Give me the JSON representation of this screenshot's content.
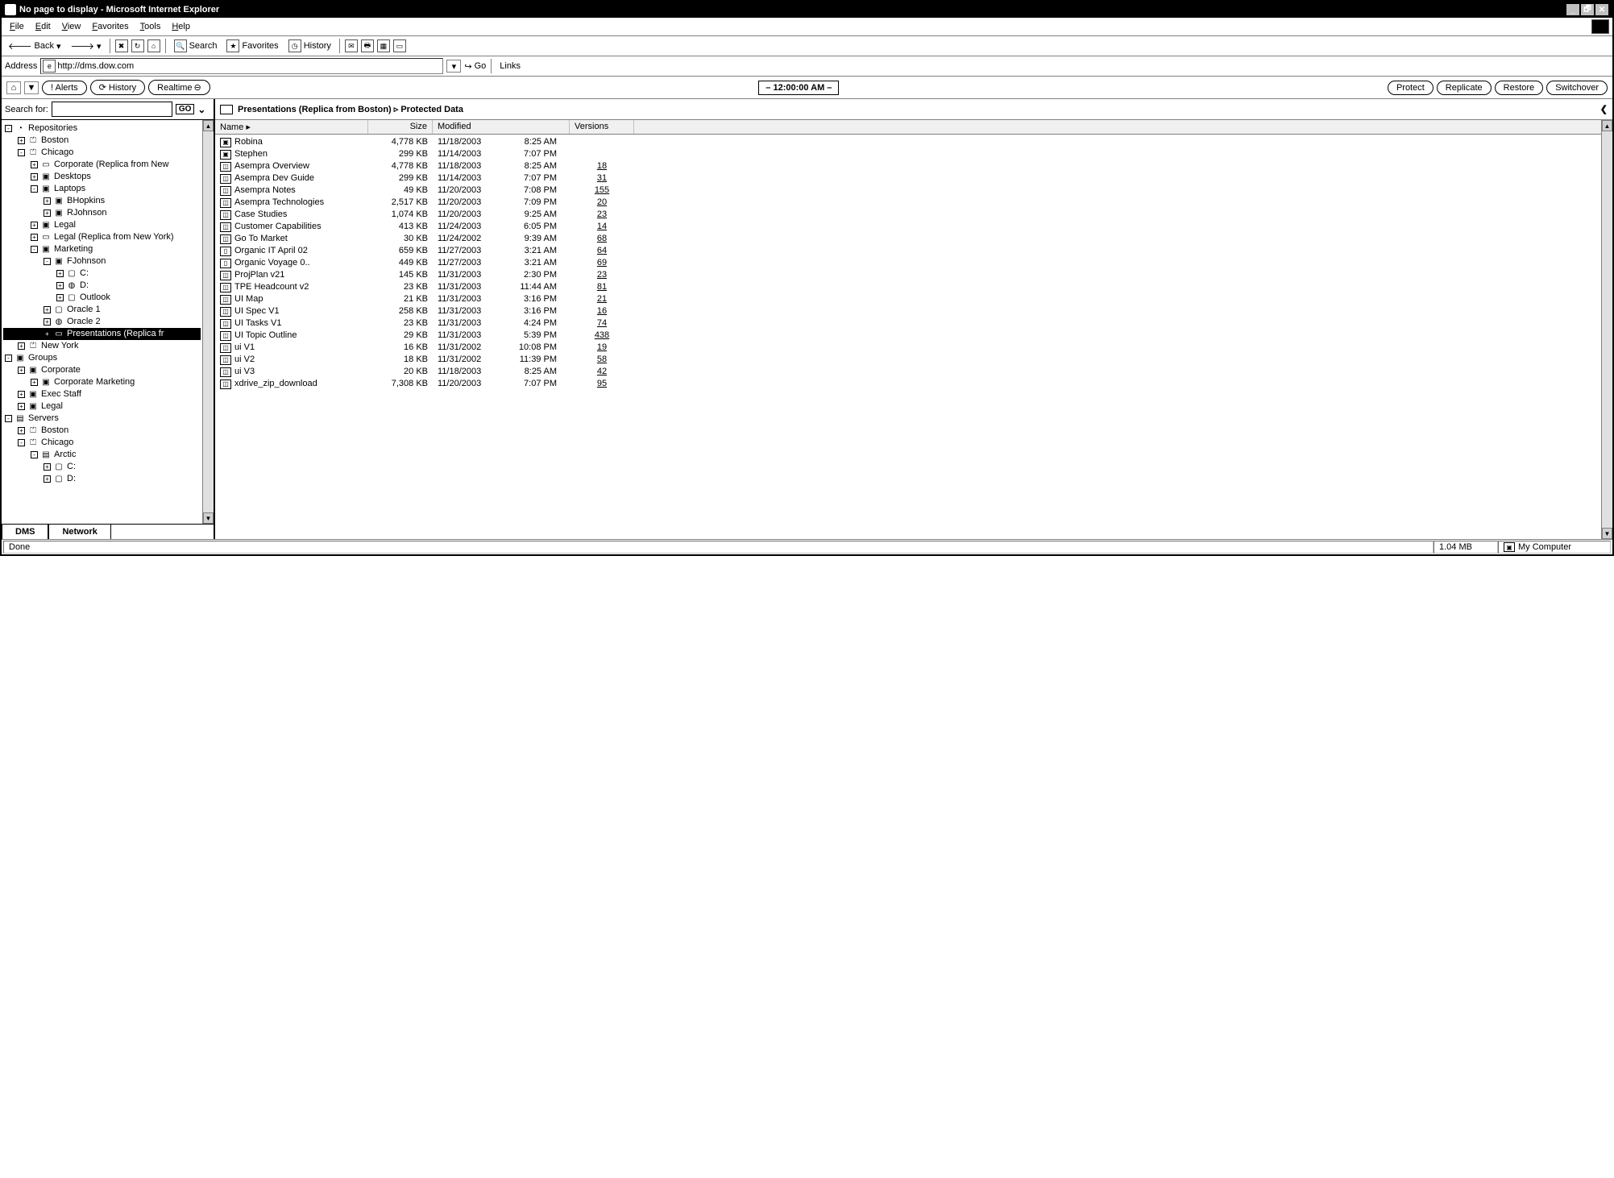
{
  "window": {
    "title": "No page to display - Microsoft Internet Explorer",
    "min": "_",
    "max": "🗗",
    "close": "✕"
  },
  "menu": {
    "items": [
      "File",
      "Edit",
      "View",
      "Favorites",
      "Tools",
      "Help"
    ]
  },
  "toolbar": {
    "back": "Back",
    "search": "Search",
    "favorites": "Favorites",
    "history": "History"
  },
  "address": {
    "label": "Address",
    "url": "http://dms.dow.com",
    "go": "Go",
    "links": "Links"
  },
  "appbar": {
    "alerts": "! Alerts",
    "history": "History",
    "realtime": "Realtime",
    "time": "– 12:00:00 AM –",
    "protect": "Protect",
    "replicate": "Replicate",
    "restore": "Restore",
    "switchover": "Switchover"
  },
  "search": {
    "label": "Search for:",
    "go": "GO"
  },
  "tree": {
    "scroll_up": "▲",
    "scroll_down": "▼",
    "tabs": {
      "dms": "DMS",
      "network": "Network"
    },
    "items": [
      {
        "ind": 0,
        "exp": "-",
        "icon": "◔",
        "label": "Repositories"
      },
      {
        "ind": 1,
        "exp": "+",
        "icon": "⏍",
        "label": "Boston"
      },
      {
        "ind": 1,
        "exp": "-",
        "icon": "⏍",
        "label": "Chicago"
      },
      {
        "ind": 2,
        "exp": "+",
        "icon": "▭",
        "label": "Corporate  (Replica from New"
      },
      {
        "ind": 2,
        "exp": "+",
        "icon": "▣",
        "label": "Desktops"
      },
      {
        "ind": 2,
        "exp": "-",
        "icon": "▣",
        "label": "Laptops"
      },
      {
        "ind": 3,
        "exp": "+",
        "icon": "▣",
        "label": "BHopkins"
      },
      {
        "ind": 3,
        "exp": "+",
        "icon": "▣",
        "label": "RJohnson"
      },
      {
        "ind": 2,
        "exp": "+",
        "icon": "▣",
        "label": "Legal"
      },
      {
        "ind": 2,
        "exp": "+",
        "icon": "▭",
        "label": "Legal (Replica from New York)"
      },
      {
        "ind": 2,
        "exp": "-",
        "icon": "▣",
        "label": "Marketing"
      },
      {
        "ind": 3,
        "exp": "-",
        "icon": "▣",
        "label": "FJohnson"
      },
      {
        "ind": 4,
        "exp": "+",
        "icon": "▢",
        "label": "C:"
      },
      {
        "ind": 4,
        "exp": "+",
        "icon": "◍",
        "label": "D:"
      },
      {
        "ind": 4,
        "exp": "+",
        "icon": "▢",
        "label": "Outlook"
      },
      {
        "ind": 3,
        "exp": "+",
        "icon": "▢",
        "label": "Oracle 1"
      },
      {
        "ind": 3,
        "exp": "+",
        "icon": "◍",
        "label": "Oracle 2"
      },
      {
        "ind": 3,
        "exp": "+",
        "icon": "▭",
        "label": "Presentations (Replica fr",
        "selected": true
      },
      {
        "ind": 1,
        "exp": "+",
        "icon": "⏍",
        "label": "New York"
      },
      {
        "ind": 0,
        "exp": "-",
        "icon": "▣",
        "label": "Groups"
      },
      {
        "ind": 1,
        "exp": "+",
        "icon": "▣",
        "label": "Corporate"
      },
      {
        "ind": 2,
        "exp": "+",
        "icon": "▣",
        "label": "Corporate Marketing"
      },
      {
        "ind": 1,
        "exp": "+",
        "icon": "▣",
        "label": "Exec Staff"
      },
      {
        "ind": 1,
        "exp": "+",
        "icon": "▣",
        "label": "Legal"
      },
      {
        "ind": 0,
        "exp": "-",
        "icon": "▤",
        "label": "Servers"
      },
      {
        "ind": 1,
        "exp": "+",
        "icon": "⏍",
        "label": "Boston"
      },
      {
        "ind": 1,
        "exp": "-",
        "icon": "⏍",
        "label": "Chicago"
      },
      {
        "ind": 2,
        "exp": "-",
        "icon": "▤",
        "label": "Arctic"
      },
      {
        "ind": 3,
        "exp": "+",
        "icon": "▢",
        "label": "C:"
      },
      {
        "ind": 3,
        "exp": "+",
        "icon": "▢",
        "label": "D:"
      }
    ]
  },
  "content": {
    "breadcrumb": "Presentations (Replica from Boston) ▹ Protected Data",
    "chev": "❮",
    "headers": {
      "name": "Name ▸",
      "size": "Size",
      "modified": "Modified",
      "versions": "Versions"
    },
    "rows": [
      {
        "icon": "▣",
        "name": "Robina",
        "size": "4,778 KB",
        "date": "11/18/2003",
        "time": "8:25 AM",
        "ver": ""
      },
      {
        "icon": "▣",
        "name": "Stephen",
        "size": "299 KB",
        "date": "11/14/2003",
        "time": "7:07 PM",
        "ver": ""
      },
      {
        "icon": "◫",
        "name": "Asempra Overview",
        "size": "4,778 KB",
        "date": "11/18/2003",
        "time": "8:25 AM",
        "ver": "18"
      },
      {
        "icon": "◫",
        "name": "Asempra Dev Guide",
        "size": "299 KB",
        "date": "11/14/2003",
        "time": "7:07 PM",
        "ver": "31"
      },
      {
        "icon": "◫",
        "name": "Asempra Notes",
        "size": "49 KB",
        "date": "11/20/2003",
        "time": "7:08 PM",
        "ver": "155"
      },
      {
        "icon": "◫",
        "name": "Asempra Technologies",
        "size": "2,517 KB",
        "date": "11/20/2003",
        "time": "7:09 PM",
        "ver": "20"
      },
      {
        "icon": "◫",
        "name": "Case Studies",
        "size": "1,074 KB",
        "date": "11/20/2003",
        "time": "9:25 AM",
        "ver": "23"
      },
      {
        "icon": "◫",
        "name": "Customer Capabilities",
        "size": "413 KB",
        "date": "11/24/2003",
        "time": "6:05 PM",
        "ver": "14"
      },
      {
        "icon": "◫",
        "name": "Go To Market",
        "size": "30 KB",
        "date": "11/24/2002",
        "time": "9:39 AM",
        "ver": "68"
      },
      {
        "icon": "▯",
        "name": "Organic IT April 02",
        "size": "659 KB",
        "date": "11/27/2003",
        "time": "3:21 AM",
        "ver": "64"
      },
      {
        "icon": "▯",
        "name": "Organic Voyage 0..",
        "size": "449 KB",
        "date": "11/27/2003",
        "time": "3:21 AM",
        "ver": "69"
      },
      {
        "icon": "◫",
        "name": "ProjPlan v21",
        "size": "145 KB",
        "date": "11/31/2003",
        "time": "2:30 PM",
        "ver": "23"
      },
      {
        "icon": "◫",
        "name": "TPE Headcount v2",
        "size": "23 KB",
        "date": "11/31/2003",
        "time": "11:44 AM",
        "ver": "81"
      },
      {
        "icon": "◫",
        "name": "UI Map",
        "size": "21 KB",
        "date": "11/31/2003",
        "time": "3:16 PM",
        "ver": "21"
      },
      {
        "icon": "◫",
        "name": "UI Spec V1",
        "size": "258 KB",
        "date": "11/31/2003",
        "time": "3:16 PM",
        "ver": "16"
      },
      {
        "icon": "◫",
        "name": "UI Tasks V1",
        "size": "23 KB",
        "date": "11/31/2003",
        "time": "4:24 PM",
        "ver": "74"
      },
      {
        "icon": "◫",
        "name": "UI Topic Outline",
        "size": "29 KB",
        "date": "11/31/2003",
        "time": "5:39 PM",
        "ver": "438"
      },
      {
        "icon": "◫",
        "name": "ui V1",
        "size": "16 KB",
        "date": "11/31/2002",
        "time": "10:08 PM",
        "ver": "19"
      },
      {
        "icon": "◫",
        "name": "ui V2",
        "size": "18 KB",
        "date": "11/31/2002",
        "time": "11:39 PM",
        "ver": "58"
      },
      {
        "icon": "◫",
        "name": "ui V3",
        "size": "20 KB",
        "date": "11/18/2003",
        "time": "8:25 AM",
        "ver": "42"
      },
      {
        "icon": "◫",
        "name": "xdrive_zip_download",
        "size": "7,308 KB",
        "date": "11/20/2003",
        "time": "7:07 PM",
        "ver": "95"
      }
    ]
  },
  "status": {
    "done": "Done",
    "size": "1.04 MB",
    "zone": "My Computer"
  }
}
